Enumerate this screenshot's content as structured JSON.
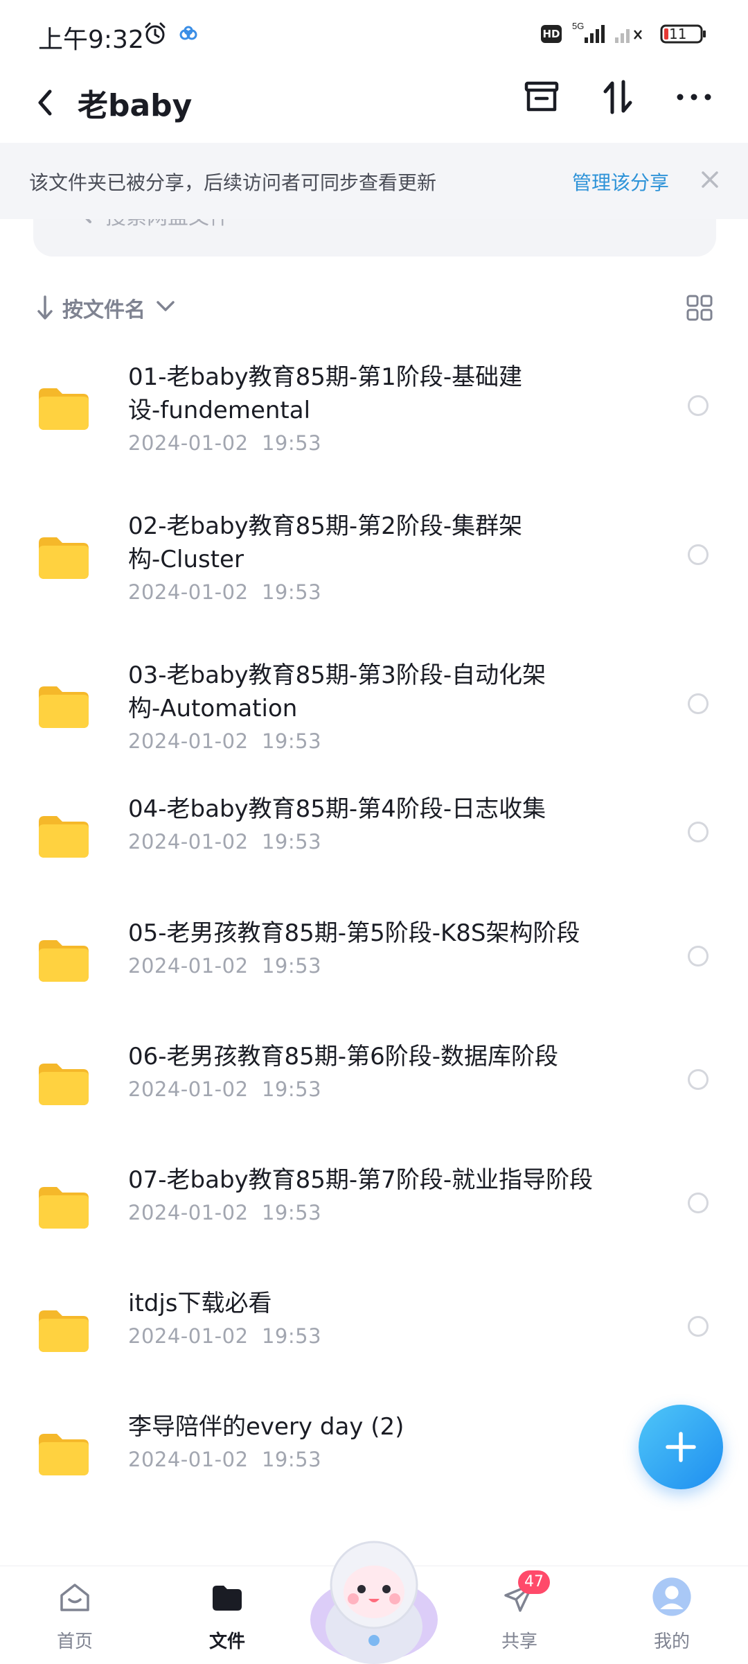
{
  "status_bar": {
    "time": "上午9:32",
    "hd_label": "HD",
    "network_label": "5G",
    "battery": "11"
  },
  "header": {
    "title": "老baby"
  },
  "notice": {
    "text": "该文件夹已被分享，后续访问者可同步查看更新",
    "link": "管理该分享"
  },
  "search": {
    "placeholder": "搜索网盘文件"
  },
  "sort": {
    "label": "按文件名"
  },
  "files": [
    {
      "name_line1": "01-老baby教育85期-第1阶段-基础建",
      "name_line2": "设-fundemental",
      "date": "2024-01-02  19:53"
    },
    {
      "name_line1": "02-老baby教育85期-第2阶段-集群架",
      "name_line2": "构-Cluster",
      "date": "2024-01-02  19:53"
    },
    {
      "name_line1": "03-老baby教育85期-第3阶段-自动化架",
      "name_line2": "构-Automation",
      "date": "2024-01-02  19:53"
    },
    {
      "name_line1": "04-老baby教育85期-第4阶段-日志收集",
      "name_line2": "",
      "date": "2024-01-02  19:53"
    },
    {
      "name_line1": "05-老男孩教育85期-第5阶段-K8S架构阶段",
      "name_line2": "",
      "date": "2024-01-02  19:53"
    },
    {
      "name_line1": "06-老男孩教育85期-第6阶段-数据库阶段",
      "name_line2": "",
      "date": "2024-01-02  19:53"
    },
    {
      "name_line1": "07-老baby教育85期-第7阶段-就业指导阶段",
      "name_line2": "",
      "date": "2024-01-02  19:53"
    },
    {
      "name_line1": "itdjs下载必看",
      "name_line2": "",
      "date": "2024-01-02  19:53"
    },
    {
      "name_line1": "李导陪伴的every day (2)",
      "name_line2": "",
      "date": "2024-01-02  19:53"
    }
  ],
  "bottom_nav": {
    "home": "首页",
    "files": "文件",
    "share": "共享",
    "share_badge": "47",
    "mine": "我的"
  },
  "colors": {
    "accent": "#2e93d8",
    "badge": "#ff4a6a",
    "folder": "#ffc93c"
  }
}
